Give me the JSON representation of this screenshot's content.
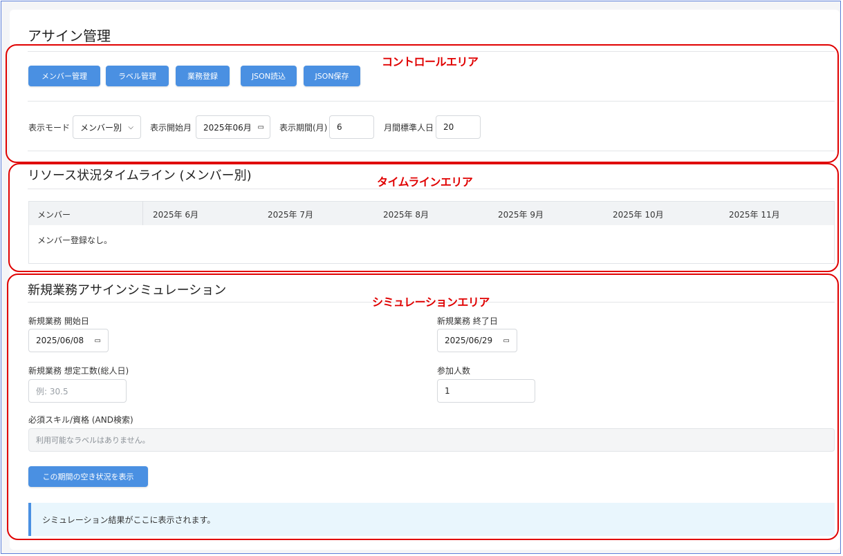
{
  "page": {
    "title": "アサイン管理"
  },
  "controls": {
    "buttons": [
      "メンバー管理",
      "ラベル管理",
      "業務登録",
      "JSON読込",
      "JSON保存"
    ],
    "display_mode_label": "表示モード",
    "display_mode_value": "メンバー別",
    "start_month_label": "表示開始月",
    "start_month_value": "2025年06月",
    "period_label": "表示期間(月)",
    "period_value": "6",
    "standard_days_label": "月間標準人日",
    "standard_days_value": "20"
  },
  "timeline": {
    "title": "リソース状況タイムライン (メンバー別)",
    "headers": [
      "メンバー",
      "2025年 6月",
      "2025年 7月",
      "2025年 8月",
      "2025年 9月",
      "2025年 10月",
      "2025年 11月"
    ],
    "empty_message": "メンバー登録なし。"
  },
  "simulation": {
    "title": "新規業務アサインシミュレーション",
    "start_date_label": "新規業務 開始日",
    "start_date_value": "2025/06/08",
    "end_date_label": "新規業務 終了日",
    "end_date_value": "2025/06/29",
    "effort_label": "新規業務 想定工数(総人日)",
    "effort_placeholder": "例: 30.5",
    "members_label": "参加人数",
    "members_value": "1",
    "skills_label": "必須スキル/資格 (AND検索)",
    "skills_empty": "利用可能なラベルはありません。",
    "show_button": "この期間の空き状況を表示",
    "result_message": "シミュレーション結果がここに表示されます。"
  },
  "annotations": {
    "control_area": "コントロールエリア",
    "timeline_area": "タイムラインエリア",
    "simulation_area": "シミュレーションエリア",
    "color": "#e00000"
  },
  "colors": {
    "accent": "#4a90e2",
    "result_bg": "#e9f6fd"
  }
}
